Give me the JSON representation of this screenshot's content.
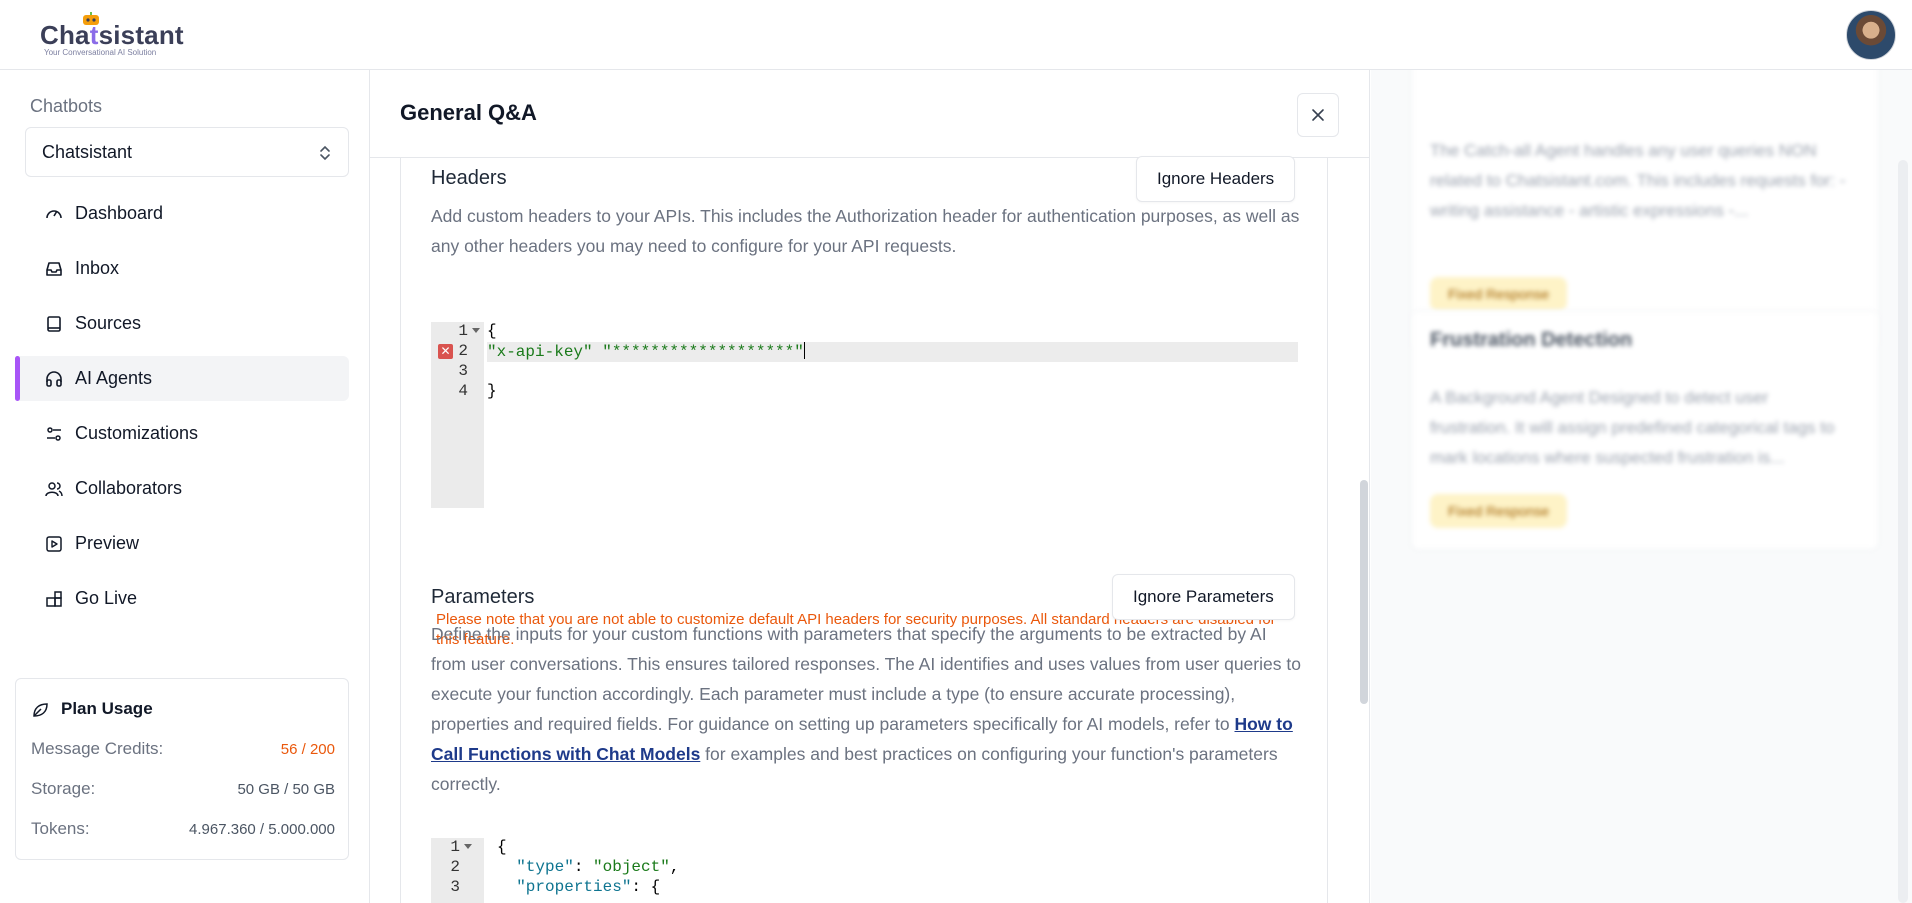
{
  "app": {
    "logo_text_a": "Cha",
    "logo_text_b": "sistant",
    "logo_tagline": "Your Conversational AI Solution"
  },
  "sidebar": {
    "section_title": "Chatbots",
    "selected_chatbot": "Chatsistant",
    "items": [
      {
        "label": "Dashboard",
        "icon": "gauge-icon"
      },
      {
        "label": "Inbox",
        "icon": "inbox-icon"
      },
      {
        "label": "Sources",
        "icon": "book-icon"
      },
      {
        "label": "AI Agents",
        "icon": "headphones-icon"
      },
      {
        "label": "Customizations",
        "icon": "sliders-icon"
      },
      {
        "label": "Collaborators",
        "icon": "users-icon"
      },
      {
        "label": "Preview",
        "icon": "play-square-icon"
      },
      {
        "label": "Go Live",
        "icon": "widgets-icon"
      }
    ],
    "active_item": "AI Agents",
    "plan": {
      "title": "Plan Usage",
      "message_credits_label": "Message Credits:",
      "message_credits_value": "56 / 200",
      "storage_label": "Storage:",
      "storage_value": "50 GB / 50 GB",
      "tokens_label": "Tokens:",
      "tokens_value": "4.967.360 / 5.000.000"
    }
  },
  "modal": {
    "title": "General Q&A",
    "headers": {
      "title": "Headers",
      "ignore_button": "Ignore Headers",
      "description": "Add custom headers to your APIs. This includes the Authorization header for authentication purposes, as well as any other headers you may need to configure for your API requests.",
      "code_lines": [
        "{",
        "\"x-api-key\" \"*******************\"",
        "",
        "}"
      ],
      "line_numbers": [
        "1",
        "2",
        "3",
        "4"
      ],
      "note": "Please note that you are not able to customize default API headers for security purposes. All standard headers are disabled for this feature."
    },
    "parameters": {
      "title": "Parameters",
      "ignore_button": "Ignore Parameters",
      "description_before": "Define the inputs for your custom functions with parameters that specify the arguments to be extracted by AI from user conversations. This ensures tailored responses. The AI identifies and uses values from user queries to execute your function accordingly. Each parameter must include a type (to ensure accurate processing), properties and required fields. For guidance on setting up parameters specifically for AI models, refer to ",
      "link_text": "How to Call Functions with Chat Models",
      "description_after": " for examples and best practices on configuring your function's parameters correctly.",
      "line_numbers": [
        "1",
        "2",
        "3"
      ],
      "code_line1": "{",
      "code_line2_key": "\"type\"",
      "code_line2_value": "\"object\"",
      "code_line3_key": "\"properties\"",
      "code_line3_rest": ": {"
    }
  },
  "background": {
    "card1_text": "The Catch-all Agent handles any user queries NON related to Chatsistant.com. This includes requests for: - writing assistance - artistic expressions -...",
    "card1_pill": "Fixed Response",
    "card2_title": "Frustration Detection",
    "card2_text": "A Background Agent Designed to detect user frustration. It will assign predefined categorical tags to mark locations where suspected frustration is...",
    "card2_pill": "Fixed Response"
  },
  "colors": {
    "accent": "#a855f7",
    "warning": "#ea580c",
    "link": "#1e3a8a"
  }
}
